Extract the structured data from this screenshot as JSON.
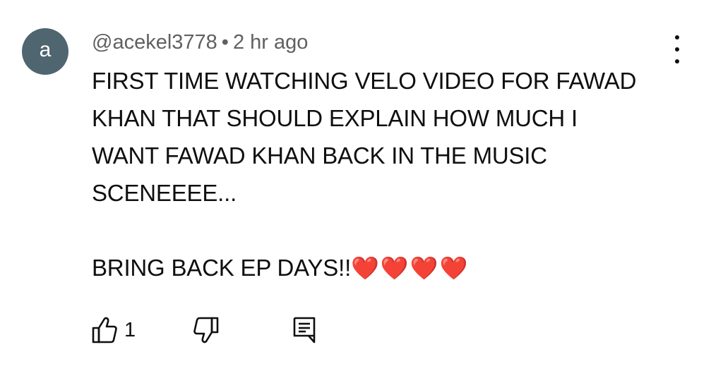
{
  "comment": {
    "avatar_letter": "a",
    "author": "@acekel3778",
    "separator": "•",
    "timestamp": "2 hr ago",
    "body_lines": [
      "FIRST TIME WATCHING VELO VIDEO FOR FAWAD",
      "KHAN THAT SHOULD EXPLAIN HOW MUCH I",
      "WANT FAWAD KHAN BACK IN THE MUSIC",
      "SCENEEEE..."
    ],
    "closing_text": "BRING BACK EP DAYS!!",
    "closing_emoji": "❤️❤️❤️❤️",
    "like_count": "1"
  },
  "icons": {
    "more": "more-vert-icon",
    "like": "thumb-up-icon",
    "dislike": "thumb-down-icon",
    "reply": "reply-comment-icon"
  }
}
